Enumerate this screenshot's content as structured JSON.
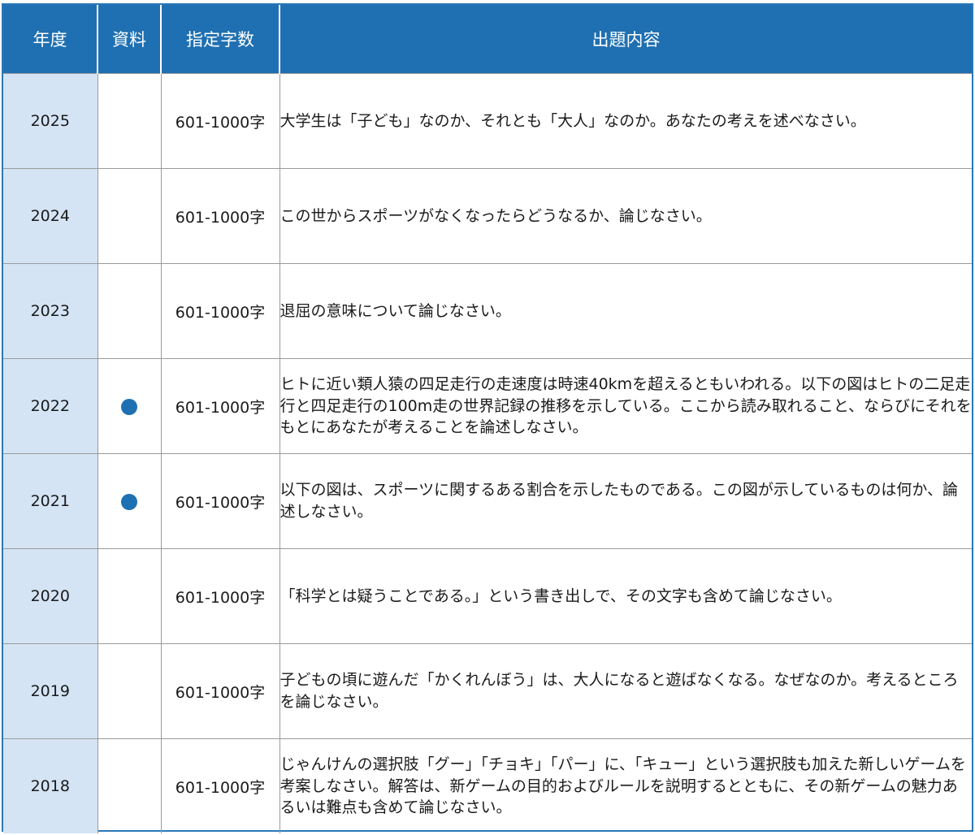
{
  "header": {
    "year": "年度",
    "material": "資料",
    "char_limit": "指定字数",
    "question": "出題内容"
  },
  "colors": {
    "header_bg": "#1f70b2",
    "year_cell_bg": "#d4e4f5",
    "material_dot": "#1f70b2"
  },
  "rows": [
    {
      "year": "2025",
      "has_material": false,
      "char_limit": "601-1000字",
      "question": "大学生は「子ども」なのか、それとも「大人」なのか。あなたの考えを述べなさい。"
    },
    {
      "year": "2024",
      "has_material": false,
      "char_limit": "601-1000字",
      "question": "この世からスポーツがなくなったらどうなるか、論じなさい。"
    },
    {
      "year": "2023",
      "has_material": false,
      "char_limit": "601-1000字",
      "question": "退屈の意味について論じなさい。"
    },
    {
      "year": "2022",
      "has_material": true,
      "char_limit": "601-1000字",
      "question": "ヒトに近い類人猿の四足走行の走速度は時速40kmを超えるともいわれる。以下の図はヒトの二足走行と四足走行の100m走の世界記録の推移を示している。ここから読み取れること、ならびにそれをもとにあなたが考えることを論述しなさい。"
    },
    {
      "year": "2021",
      "has_material": true,
      "char_limit": "601-1000字",
      "question": "以下の図は、スポーツに関するある割合を示したものである。この図が示しているものは何か、論述しなさい。"
    },
    {
      "year": "2020",
      "has_material": false,
      "char_limit": "601-1000字",
      "question": "「科学とは疑うことである。」という書き出しで、その文字も含めて論じなさい。"
    },
    {
      "year": "2019",
      "has_material": false,
      "char_limit": "601-1000字",
      "question": "子どもの頃に遊んだ「かくれんぼう」は、大人になると遊ばなくなる。なぜなのか。考えるところを論じなさい。"
    },
    {
      "year": "2018",
      "has_material": false,
      "char_limit": "601-1000字",
      "question": "じゃんけんの選択肢「グー」「チョキ」「パー」に、「キュー」という選択肢も加えた新しいゲームを考案しなさい。解答は、新ゲームの目的およびルールを説明するとともに、その新ゲームの魅力あるいは難点も含めて論じなさい。"
    }
  ]
}
